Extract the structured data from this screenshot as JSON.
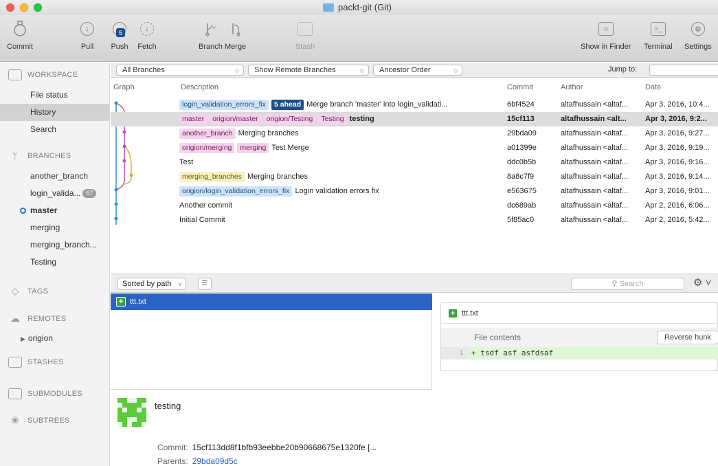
{
  "window": {
    "title": "packt-git (Git)"
  },
  "toolbar": {
    "commit": "Commit",
    "pull": "Pull",
    "push": "Push",
    "push_badge": "5",
    "fetch": "Fetch",
    "branch": "Branch",
    "merge": "Merge",
    "stash": "Stash",
    "show_in_finder": "Show in Finder",
    "terminal": "Terminal",
    "settings": "Settings"
  },
  "sidebar": {
    "workspace": {
      "title": "WORKSPACE",
      "items": [
        "File status",
        "History",
        "Search"
      ]
    },
    "branches": {
      "title": "BRANCHES",
      "items": [
        {
          "label": "another_branch",
          "badge": ""
        },
        {
          "label": "login_valida...",
          "badge": "57"
        },
        {
          "label": "master",
          "badge": ""
        },
        {
          "label": "merging",
          "badge": ""
        },
        {
          "label": "merging_branch...",
          "badge": ""
        },
        {
          "label": "Testing",
          "badge": ""
        }
      ]
    },
    "tags": "TAGS",
    "remotes": {
      "title": "REMOTES",
      "items": [
        "origion"
      ]
    },
    "stashes": "STASHES",
    "submodules": "SUBMODULES",
    "subtrees": "SUBTREES"
  },
  "filters": {
    "branches": "All Branches",
    "remote": "Show Remote Branches",
    "order": "Ancestor Order",
    "jump_label": "Jump to:"
  },
  "table": {
    "headers": {
      "graph": "Graph",
      "description": "Description",
      "commit": "Commit",
      "author": "Author",
      "date": "Date"
    },
    "rows": [
      {
        "refs": [
          {
            "t": "login_validation_errors_fix",
            "c": "blue"
          },
          {
            "t": "5 ahead",
            "c": "ahead"
          }
        ],
        "message": "Merge branch 'master' into login_validati...",
        "commit": "6bf4524",
        "author": "altafhussain <altaf...",
        "date": "Apr 3, 2016, 10:4..."
      },
      {
        "refs": [
          {
            "t": "master",
            "c": "pink"
          },
          {
            "t": "origion/master",
            "c": "pink"
          },
          {
            "t": "origion/Testing",
            "c": "pink"
          },
          {
            "t": "Testing",
            "c": "pink"
          }
        ],
        "message": "testing",
        "commit": "15cf113",
        "author": "altafhussain <alt...",
        "date": "Apr 3, 2016, 9:2..."
      },
      {
        "refs": [
          {
            "t": "another_branch",
            "c": "pink"
          }
        ],
        "message": "Merging branches",
        "commit": "29bda09",
        "author": "altafhussain <altaf...",
        "date": "Apr 3, 2016, 9:27..."
      },
      {
        "refs": [
          {
            "t": "origion/merging",
            "c": "pink"
          },
          {
            "t": "merging",
            "c": "pink"
          }
        ],
        "message": "Test Merge",
        "commit": "a01399e",
        "author": "altafhussain <altaf...",
        "date": "Apr 3, 2016, 9:19..."
      },
      {
        "refs": [],
        "message": "Test",
        "commit": "ddc0b5b",
        "author": "altafhussain <altaf...",
        "date": "Apr 3, 2016, 9:16..."
      },
      {
        "refs": [
          {
            "t": "merging_branches",
            "c": "yellow"
          }
        ],
        "message": "Merging branches",
        "commit": "8a8c7f9",
        "author": "altafhussain <altaf...",
        "date": "Apr 3, 2016, 9:14..."
      },
      {
        "refs": [
          {
            "t": "origion/login_validation_errors_fix",
            "c": "blue"
          }
        ],
        "message": "Login validation errors fix",
        "commit": "e563675",
        "author": "altafhussain <altaf...",
        "date": "Apr 3, 2016, 9:01..."
      },
      {
        "refs": [],
        "message": "Another commit",
        "commit": "dc689ab",
        "author": "altafhussain <altaf...",
        "date": "Apr 2, 2016, 6:06..."
      },
      {
        "refs": [],
        "message": "Initial Commit",
        "commit": "5f85ac0",
        "author": "altafhussain <altaf...",
        "date": "Apr 2, 2016, 5:42..."
      }
    ]
  },
  "files": {
    "sort": "Sorted by path",
    "search_placeholder": "Search",
    "items": [
      "ttt.txt"
    ]
  },
  "detail": {
    "subject": "testing",
    "commit_label": "Commit:",
    "commit_value": "15cf113dd8f1bfb93eebbe20b90668675e1320fe [...",
    "parents_label": "Parents:",
    "parents_value": "29bda09d5c"
  },
  "diff": {
    "file": "ttt.txt",
    "hunk_label": "File contents",
    "reverse_button": "Reverse hunk",
    "line_number": "1",
    "line_text": "+ tsdf asf asfdsaf"
  },
  "colors": {
    "selection": "#2963c4",
    "ref_blue": "#cfe3f7",
    "ref_pink": "#f6d2ec",
    "ref_yellow": "#fbf0c2",
    "ahead": "#1f4f86"
  }
}
